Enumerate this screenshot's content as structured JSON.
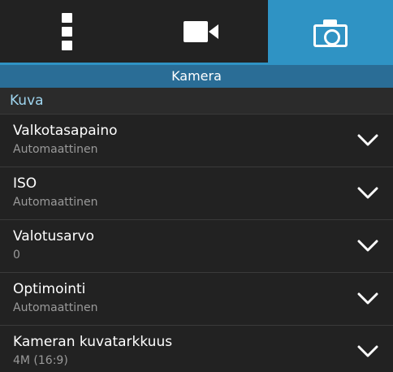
{
  "tabs": [
    {
      "name": "more-tab",
      "icon": "vertical-dots-icon",
      "active": false
    },
    {
      "name": "video-tab",
      "icon": "video-camera-icon",
      "active": false
    },
    {
      "name": "camera-tab",
      "icon": "camera-icon",
      "active": true
    }
  ],
  "header": {
    "title": "Kamera"
  },
  "section": {
    "label": "Kuva"
  },
  "settings": [
    {
      "title": "Valkotasapaino",
      "value": "Automaattinen"
    },
    {
      "title": "ISO",
      "value": "Automaattinen"
    },
    {
      "title": "Valotusarvo",
      "value": "0"
    },
    {
      "title": "Optimointi",
      "value": "Automaattinen"
    },
    {
      "title": "Kameran kuvatarkkuus",
      "value": "4M (16:9)"
    }
  ],
  "colors": {
    "accent": "#2f93c4",
    "header": "#2a6d96",
    "section_label": "#9fd5ef",
    "background": "#222222"
  }
}
